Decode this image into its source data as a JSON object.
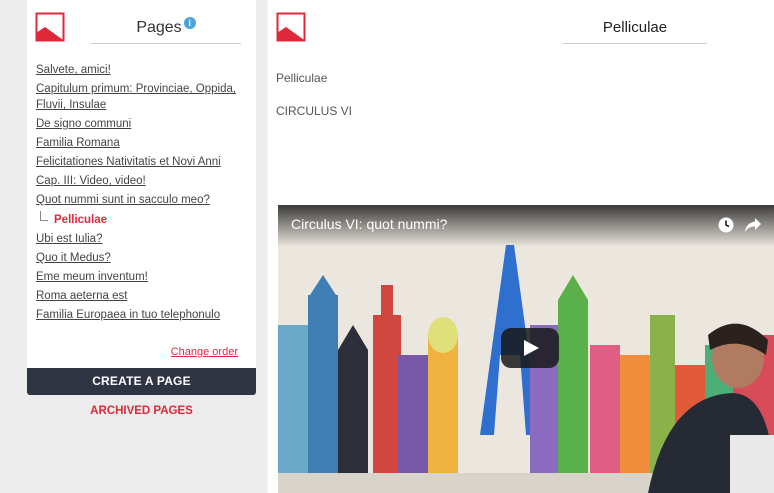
{
  "sidebar": {
    "title": "Pages",
    "info_glyph": "i",
    "items": [
      {
        "label": "Salvete, amici!"
      },
      {
        "label": "Capitulum primum: Provinciae, Oppida, Fluvii, Insulae"
      },
      {
        "label": "De signo communi"
      },
      {
        "label": "Familia Romana"
      },
      {
        "label": "Felicitationes Nativitatis et Novi Anni"
      },
      {
        "label": "Cap. III: Video, video!"
      },
      {
        "label": "Quot nummi sunt in sacculo meo?"
      },
      {
        "label": "Pelliculae",
        "current": true
      },
      {
        "label": "Ubi est Iulia?"
      },
      {
        "label": "Quo it Medus?"
      },
      {
        "label": "Eme meum inventum!"
      },
      {
        "label": "Roma aeterna est"
      },
      {
        "label": "Familia Europaea in tuo telephonulo"
      }
    ],
    "change_order": "Change order",
    "create_button": "CREATE A PAGE",
    "archived_link": "ARCHIVED PAGES"
  },
  "main": {
    "title": "Pelliculae",
    "page_name": "Pelliculae",
    "group": "CIRCULUS VI",
    "video": {
      "title": "Circulus VI: quot nummi?",
      "icons": [
        "clock-icon",
        "share-icon",
        "play-icon"
      ]
    }
  },
  "colors": {
    "accent": "#e0283b",
    "button_bg": "#2f3443",
    "info": "#4da3d6"
  }
}
